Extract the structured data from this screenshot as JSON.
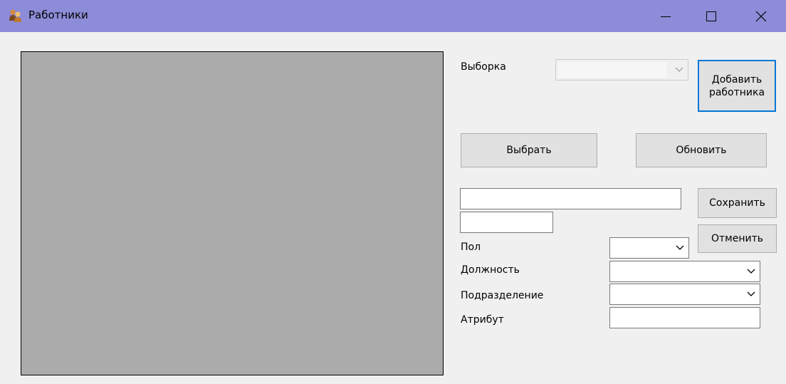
{
  "window": {
    "title": "Работники",
    "controls": {
      "minimize": "minimize-icon",
      "maximize": "maximize-icon",
      "close": "close-icon"
    }
  },
  "form": {
    "selection_label": "Выборка",
    "add_employee_button": "Добавить работника",
    "select_button": "Выбрать",
    "refresh_button": "Обновить",
    "save_button": "Сохранить",
    "cancel_button": "Отменить",
    "gender_label": "Пол",
    "position_label": "Должность",
    "department_label": "Подразделение",
    "attribute_label": "Атрибут",
    "text_field_1": "",
    "text_field_2": "",
    "gender_value": "",
    "position_value": "",
    "department_value": "",
    "attribute_value": "",
    "selection_value": ""
  },
  "colors": {
    "titlebar": "#8c8cd8",
    "grid_background": "#ababab",
    "focus_border": "#0078d7"
  }
}
